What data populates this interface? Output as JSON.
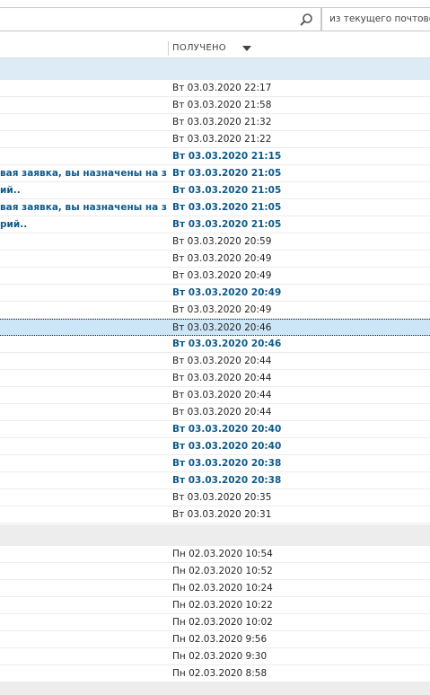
{
  "search": {
    "placeholder": "",
    "scope_label": "из текущего почтово"
  },
  "columns": {
    "received": "ПОЛУЧЕНО"
  },
  "group1": {
    "rows": [
      {
        "subject": "",
        "date": "Вт 03.03.2020 22:17",
        "unread": false,
        "selected": false
      },
      {
        "subject": "",
        "date": "Вт 03.03.2020 21:58",
        "unread": false,
        "selected": false
      },
      {
        "subject": "",
        "date": "Вт 03.03.2020 21:32",
        "unread": false,
        "selected": false
      },
      {
        "subject": "",
        "date": "Вт 03.03.2020 21:22",
        "unread": false,
        "selected": false
      },
      {
        "subject": "",
        "date": "Вт 03.03.2020 21:15",
        "unread": true,
        "selected": false
      },
      {
        "subject": "вая заявка, вы назначены на зая...",
        "date": "Вт 03.03.2020 21:05",
        "unread": true,
        "selected": false
      },
      {
        "subject": "ий..",
        "date": "Вт 03.03.2020 21:05",
        "unread": true,
        "selected": false
      },
      {
        "subject": "вая заявка, вы назначены на зая...",
        "date": "Вт 03.03.2020 21:05",
        "unread": true,
        "selected": false
      },
      {
        "subject": "рий..",
        "date": "Вт 03.03.2020 21:05",
        "unread": true,
        "selected": false
      },
      {
        "subject": "",
        "date": "Вт 03.03.2020 20:59",
        "unread": false,
        "selected": false
      },
      {
        "subject": "",
        "date": "Вт 03.03.2020 20:49",
        "unread": false,
        "selected": false
      },
      {
        "subject": "",
        "date": "Вт 03.03.2020 20:49",
        "unread": false,
        "selected": false
      },
      {
        "subject": "",
        "date": "Вт 03.03.2020 20:49",
        "unread": true,
        "selected": false
      },
      {
        "subject": "",
        "date": "Вт 03.03.2020 20:49",
        "unread": false,
        "selected": false
      },
      {
        "subject": "",
        "date": "Вт 03.03.2020 20:46",
        "unread": false,
        "selected": true
      },
      {
        "subject": "",
        "date": "Вт 03.03.2020 20:46",
        "unread": true,
        "selected": false
      },
      {
        "subject": "",
        "date": "Вт 03.03.2020 20:44",
        "unread": false,
        "selected": false
      },
      {
        "subject": "",
        "date": "Вт 03.03.2020 20:44",
        "unread": false,
        "selected": false
      },
      {
        "subject": "",
        "date": "Вт 03.03.2020 20:44",
        "unread": false,
        "selected": false
      },
      {
        "subject": "",
        "date": "Вт 03.03.2020 20:44",
        "unread": false,
        "selected": false
      },
      {
        "subject": "",
        "date": "Вт 03.03.2020 20:40",
        "unread": true,
        "selected": false
      },
      {
        "subject": "",
        "date": "Вт 03.03.2020 20:40",
        "unread": true,
        "selected": false
      },
      {
        "subject": "",
        "date": "Вт 03.03.2020 20:38",
        "unread": true,
        "selected": false
      },
      {
        "subject": "",
        "date": "Вт 03.03.2020 20:38",
        "unread": true,
        "selected": false
      },
      {
        "subject": "",
        "date": "Вт 03.03.2020 20:35",
        "unread": false,
        "selected": false
      },
      {
        "subject": "",
        "date": "Вт 03.03.2020 20:31",
        "unread": false,
        "selected": false
      }
    ]
  },
  "group2": {
    "rows": [
      {
        "subject": "",
        "date": "Пн 02.03.2020 10:54",
        "unread": false,
        "selected": false
      },
      {
        "subject": "",
        "date": "Пн 02.03.2020 10:52",
        "unread": false,
        "selected": false
      },
      {
        "subject": "",
        "date": "Пн 02.03.2020 10:24",
        "unread": false,
        "selected": false
      },
      {
        "subject": "",
        "date": "Пн 02.03.2020 10:22",
        "unread": false,
        "selected": false
      },
      {
        "subject": "",
        "date": "Пн 02.03.2020 10:02",
        "unread": false,
        "selected": false
      },
      {
        "subject": "",
        "date": "Пн 02.03.2020 9:56",
        "unread": false,
        "selected": false
      },
      {
        "subject": "",
        "date": "Пн 02.03.2020 9:30",
        "unread": false,
        "selected": false
      },
      {
        "subject": "",
        "date": "Пн 02.03.2020 8:58",
        "unread": false,
        "selected": false
      }
    ]
  },
  "colors": {
    "accent": "#0e5a8a",
    "selected_row": "#cde6f7",
    "group_band_first": "#dcebf6",
    "group_band": "#ededed"
  }
}
